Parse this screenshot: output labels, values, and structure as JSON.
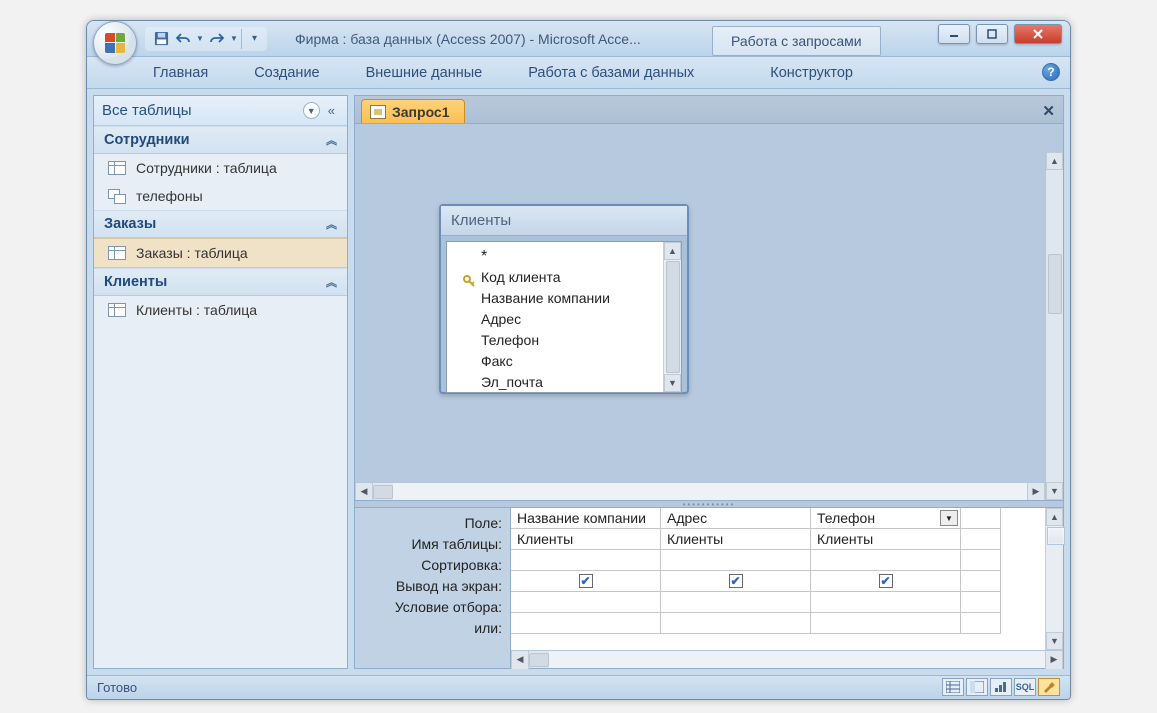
{
  "titlebar": {
    "title": "Фирма : база данных (Access 2007)  -  Microsoft Acce...",
    "context_tab": "Работа с запросами"
  },
  "ribbon": {
    "tabs": [
      "Главная",
      "Создание",
      "Внешние данные",
      "Работа с базами данных",
      "Конструктор"
    ]
  },
  "nav": {
    "header": "Все таблицы",
    "groups": [
      {
        "title": "Сотрудники",
        "items": [
          {
            "type": "table",
            "label": "Сотрудники : таблица"
          },
          {
            "type": "query",
            "label": "телефоны"
          }
        ]
      },
      {
        "title": "Заказы",
        "items": [
          {
            "type": "table",
            "label": "Заказы : таблица",
            "selected": true
          }
        ]
      },
      {
        "title": "Клиенты",
        "items": [
          {
            "type": "table",
            "label": "Клиенты : таблица"
          }
        ]
      }
    ]
  },
  "doc_tab": "Запрос1",
  "tablebox": {
    "title": "Клиенты",
    "fields": [
      "*",
      "Код клиента",
      "Название компании",
      "Адрес",
      "Телефон",
      "Факс",
      "Эл_почта"
    ],
    "key_index": 1
  },
  "grid": {
    "labels": [
      "Поле:",
      "Имя таблицы:",
      "Сортировка:",
      "Вывод на экран:",
      "Условие отбора:",
      "или:"
    ],
    "columns": [
      {
        "field": "Название компании",
        "table": "Клиенты",
        "show": true
      },
      {
        "field": "Адрес",
        "table": "Клиенты",
        "show": true
      },
      {
        "field": "Телефон",
        "table": "Клиенты",
        "show": true,
        "dropdown": true
      }
    ]
  },
  "status": "Готово",
  "viewbuttons": [
    "datasheet-icon",
    "pivottable-icon",
    "pivotchart-icon",
    "sql-icon",
    "design-icon"
  ],
  "sql_label": "SQL"
}
